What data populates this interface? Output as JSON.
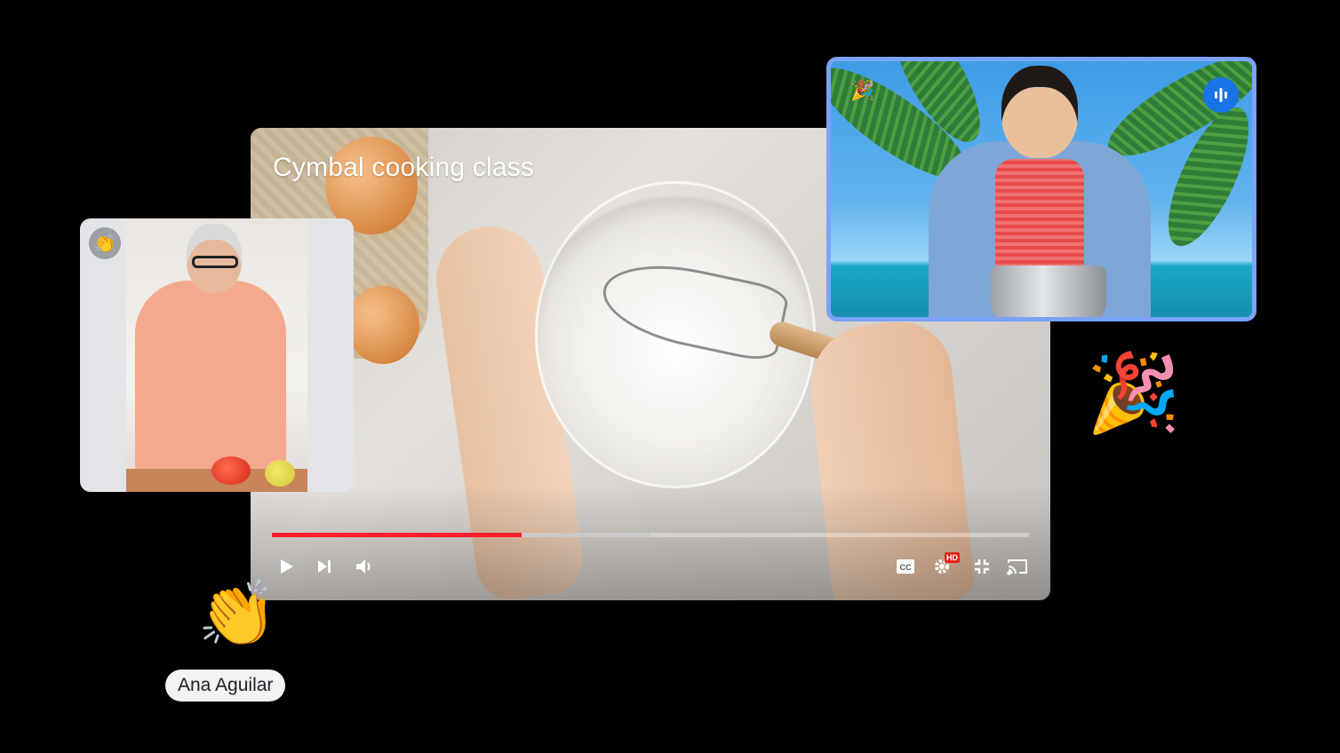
{
  "main_video": {
    "title": "Cymbal cooking class",
    "progress_played": 0.33,
    "progress_buffered": 0.5,
    "controls": {
      "left": [
        "play-icon",
        "skip-next-icon",
        "volume-icon"
      ],
      "right": [
        "closed-captions-icon",
        "settings-icon",
        "exit-fullscreen-icon",
        "cast-icon"
      ],
      "quality_badge": "HD"
    },
    "colors": {
      "played": "#ff1f2d",
      "quality_badge": "#e62117"
    }
  },
  "participants": {
    "left_tile": {
      "reaction_badge": "👏",
      "badge_icon": "hand-clap-icon"
    },
    "right_tile": {
      "reaction_badge": "🎉",
      "speaking_indicator": "audio-waveform-icon",
      "border_color": "#7ba3f7",
      "indicator_color": "#1a73e8"
    }
  },
  "reactions": {
    "party": "🎉",
    "clap": "👏",
    "clap_sender": "Ana Aguilar"
  }
}
